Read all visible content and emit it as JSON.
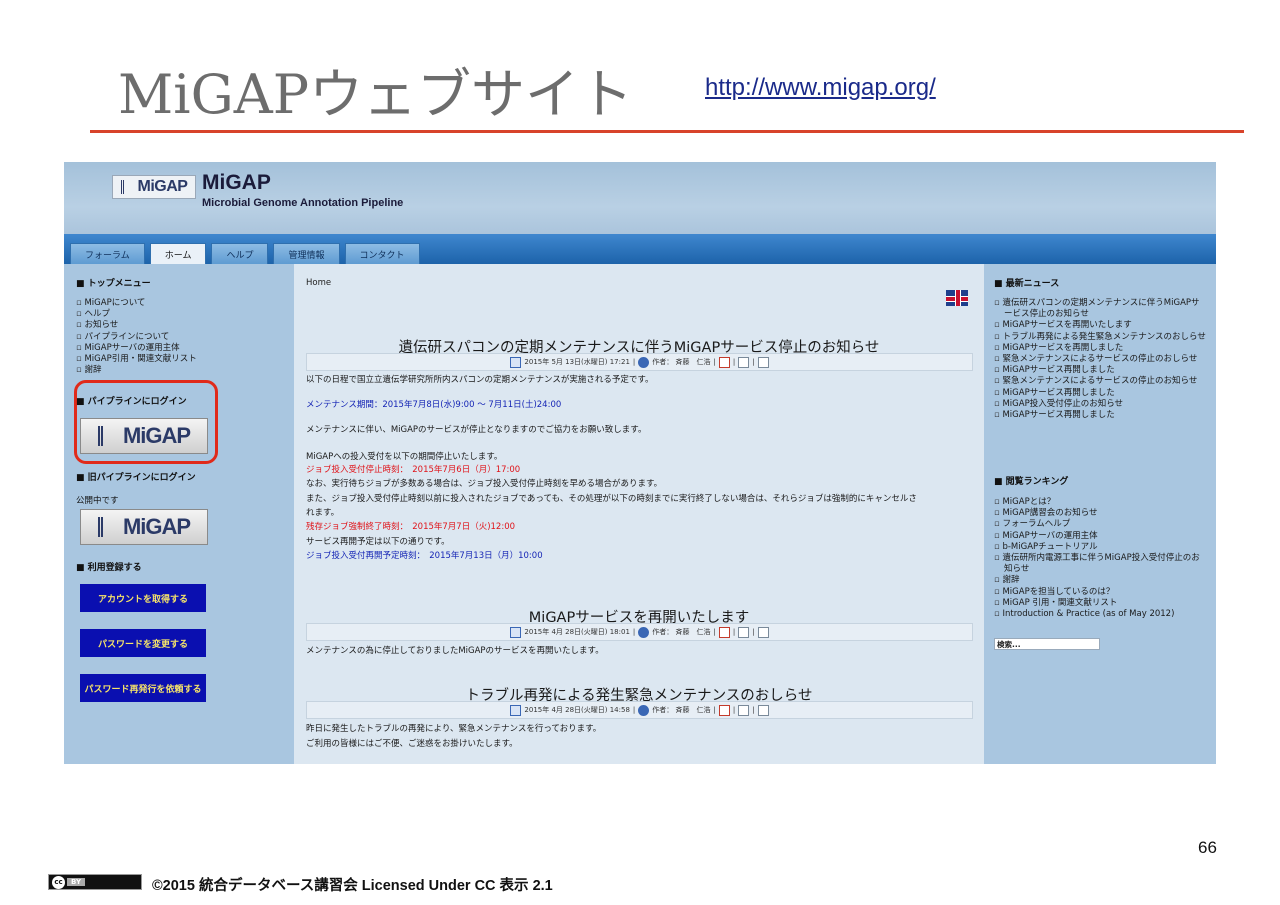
{
  "slide": {
    "title": "MiGAPウェブサイト",
    "url": "http://www.migap.org/",
    "page_number": "66",
    "copyright": "©2015 統合データベース講習会 Licensed Under CC 表示 2.1",
    "cc_icon": "cc",
    "cc_by": "BY"
  },
  "site": {
    "logo_text": "MiGAP",
    "name": "MiGAP",
    "subtitle": "Microbial Genome Annotation Pipeline"
  },
  "nav": {
    "tabs": [
      "フォーラム",
      "ホーム",
      "ヘルプ",
      "管理情報",
      "コンタクト"
    ],
    "active_index": 1
  },
  "left": {
    "top_menu_heading": "トップメニュー",
    "top_menu": [
      "MiGAPについて",
      "ヘルプ",
      "お知らせ",
      "パイプラインについて",
      "MiGAPサーバの運用主体",
      "MiGAP引用・関連文献リスト",
      "謝辞"
    ],
    "login_heading": "パイプラインにログイン",
    "login_logo": "MiGAP",
    "old_login_heading": "旧パイプラインにログイン",
    "public_text": "公開中です",
    "old_login_logo": "MiGAP",
    "register_heading": "利用登録する",
    "buttons": [
      "アカウントを取得する",
      "パスワードを変更する",
      "パスワード再発行を依頼する"
    ]
  },
  "center": {
    "breadcrumb": "Home",
    "articles": [
      {
        "title": "遺伝研スパコンの定期メンテナンスに伴うMiGAPサービス停止のお知らせ",
        "date": "2015年 5月 13日(水曜日) 17:21",
        "author": "作者： 斉藤　仁浩",
        "lines": [
          {
            "text": "以下の日程で国立立遺伝学研究所所内スパコンの定期メンテナンスが実施される予定です。",
            "style": "normal"
          },
          {
            "text": "メンテナンス期間：2015年7月8日(水)9:00 〜 7月11日(土)24:00",
            "style": "blue"
          },
          {
            "text": "メンテナンスに伴い、MiGAPのサービスが停止となりますのでご協力をお願い致します。",
            "style": "normal"
          },
          {
            "text": "MiGAPへの投入受付を以下の期間停止いたします。",
            "style": "normal"
          },
          {
            "text": "ジョブ投入受付停止時刻：　2015年7月6日（月）17:00",
            "style": "red"
          },
          {
            "text": "なお、実行待ちジョブが多数ある場合は、ジョブ投入受付停止時刻を早める場合があります。",
            "style": "normal"
          },
          {
            "text": "また、ジョブ投入受付停止時刻以前に投入されたジョブであっても、その処理が以下の時刻までに実行終了しない場合は、それらジョブは強制的にキャンセルさ",
            "style": "normal"
          },
          {
            "text": "れます。",
            "style": "normal"
          },
          {
            "text": "残存ジョブ強制終了時刻：　2015年7月7日（火)12:00",
            "style": "red"
          },
          {
            "text": "サービス再開予定は以下の通りです。",
            "style": "normal"
          },
          {
            "text": "ジョブ投入受付再開予定時刻：　2015年7月13日（月）10:00",
            "style": "blue"
          }
        ]
      },
      {
        "title": "MiGAPサービスを再開いたします",
        "date": "2015年 4月 28日(火曜日) 18:01",
        "author": "作者： 斉藤　仁浩",
        "lines": [
          {
            "text": "メンテナンスの為に停止しておりましたMiGAPのサービスを再開いたします。",
            "style": "normal"
          }
        ]
      },
      {
        "title": "トラブル再発による発生緊急メンテナンスのおしらせ",
        "date": "2015年 4月 28日(火曜日) 14:58",
        "author": "作者： 斉藤　仁浩",
        "lines": [
          {
            "text": "昨日に発生したトラブルの再発により、緊急メンテナンスを行っております。",
            "style": "normal"
          },
          {
            "text": "ご利用の皆様にはご不便、ご迷惑をお掛けいたします。",
            "style": "normal"
          }
        ]
      }
    ]
  },
  "right": {
    "news_heading": "最新ニュース",
    "news": [
      "遺伝研スパコンの定期メンテナンスに伴うMiGAPサービス停止のお知らせ",
      "MiGAPサービスを再開いたします",
      "トラブル再発による発生緊急メンテナンスのおしらせ",
      "MiGAPサービスを再開しました",
      "緊急メンテナンスによるサービスの停止のおしらせ",
      "MiGAPサービス再開しました",
      "緊急メンテナンスによるサービスの停止のお知らせ",
      "MiGAPサービス再開しました",
      "MiGAP投入受付停止のお知らせ",
      "MiGAPサービス再開しました"
    ],
    "ranking_heading": "閲覧ランキング",
    "ranking": [
      "MiGAPとは？",
      "MiGAP講習会のお知らせ",
      "フォーラムヘルプ",
      "MiGAPサーバの運用主体",
      "b-MiGAPチュートリアル",
      "遺伝研所内電源工事に伴うMiGAP投入受付停止のお知らせ",
      "謝辞",
      "MiGAPを担当しているのは？",
      "MiGAP 引用・関連文献リスト",
      "Introduction & Practice (as of May 2012)"
    ],
    "search_placeholder": "検索..."
  },
  "colors": {
    "accent_red": "#d8432a",
    "nav_blue": "#1d63aa",
    "sidebar_blue": "#a9c6e0",
    "button_blue": "#0a0fb0",
    "button_text": "#f6e46a",
    "alert_red": "#e0141a",
    "info_blue": "#1525b5"
  },
  "icons": [
    "calendar-icon",
    "author-icon",
    "pdf-icon",
    "print-icon",
    "email-icon",
    "uk-flag-icon",
    "cc-license-icon"
  ]
}
